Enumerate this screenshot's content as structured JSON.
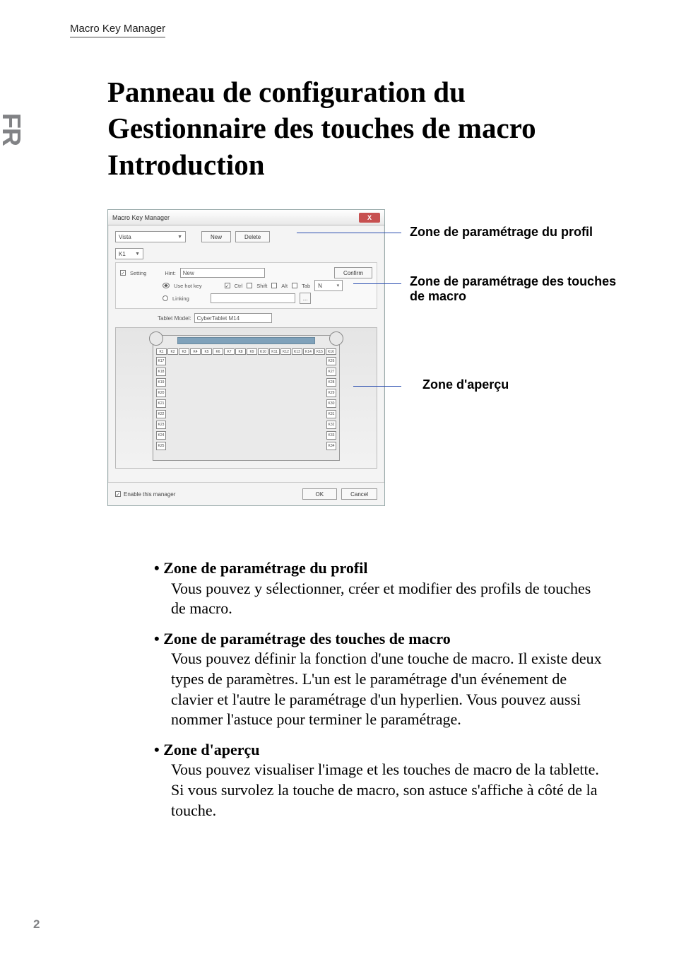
{
  "header": {
    "title": "Macro Key Manager"
  },
  "lang_tab": "FR",
  "page_title": "Panneau de configuration du Gestionnaire des touches de macro Introduction",
  "page_number": "2",
  "callouts": {
    "c1": "Zone de paramétrage du profil",
    "c2": "Zone de paramétrage des touches de macro",
    "c3": "Zone d'aperçu"
  },
  "screenshot": {
    "window_title": "Macro Key Manager",
    "close_glyph": "X",
    "profile": {
      "selected_profile": "Vista",
      "new_btn": "New",
      "delete_btn": "Delete"
    },
    "key_select": {
      "value": "K1"
    },
    "setting": {
      "checkbox_label": "Setting",
      "hint_label": "Hint:",
      "hint_value": "New",
      "confirm_btn": "Confirm",
      "hotkey_radio": "Use hot key",
      "mod_ctrl": "Ctrl",
      "mod_shift": "Shift",
      "mod_alt": "Alt",
      "mod_tab": "Tab",
      "key_value": "N",
      "linking_radio": "Linking",
      "browse_btn": "..."
    },
    "tablet_model": {
      "label": "Tablet Model:",
      "value": "CyberTablet M14"
    },
    "preview": {
      "top_keys": [
        "K1",
        "K2",
        "K3",
        "K4",
        "K5",
        "K6",
        "K7",
        "K8",
        "K9",
        "K10",
        "K11",
        "K12",
        "K13",
        "K14",
        "K15",
        "K16"
      ],
      "left_keys": [
        "K17",
        "K18",
        "K19",
        "K20",
        "K21",
        "K22",
        "K23",
        "K24",
        "K25"
      ],
      "right_keys": [
        "K26",
        "K27",
        "K28",
        "K29",
        "K30",
        "K31",
        "K32",
        "K33",
        "K34"
      ]
    },
    "footer": {
      "enable_label": "Enable this manager",
      "ok_btn": "OK",
      "cancel_btn": "Cancel"
    }
  },
  "bullets": {
    "b1_head": "Zone de paramétrage du profil",
    "b1_text": "Vous pouvez y sélectionner, créer et modifier des profils de touches de macro.",
    "b2_head": "Zone de paramétrage des touches de macro",
    "b2_text": "Vous pouvez définir la fonction d'une touche de macro. Il existe deux types de paramètres. L'un est le paramétrage d'un événement de clavier et l'autre le paramétrage d'un hyperlien. Vous pouvez aussi nommer l'astuce pour terminer le paramétrage.",
    "b3_head": "Zone d'aperçu",
    "b3_text": "Vous pouvez visualiser l'image et les touches de macro de la tablette. Si vous survolez la touche de macro, son astuce s'affiche à côté de la touche."
  }
}
